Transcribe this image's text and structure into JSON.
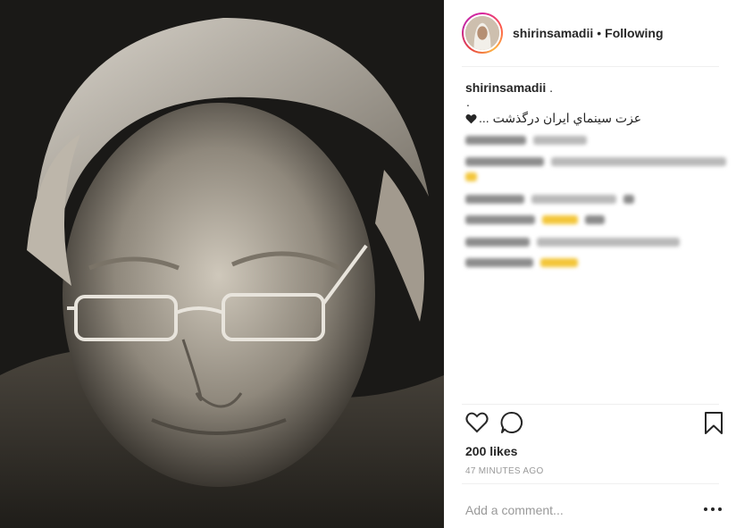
{
  "post": {
    "username": "shirinsamadii",
    "separator": "•",
    "follow_status": "Following",
    "caption_username": "shirinsamadii",
    "caption_trail": " .",
    "caption_dot": ".",
    "caption_text": "... عزت سينماي ايران درگذشت",
    "likes": "200 likes",
    "timestamp": "47 MINUTES AGO",
    "comment_placeholder": "Add a comment..."
  },
  "icons": {
    "caption_heart": "heart-icon",
    "like": "heart-outline-icon",
    "comment": "comment-bubble-icon",
    "save": "bookmark-icon",
    "more": "more-options-icon"
  },
  "colors": {
    "text": "#262626",
    "muted": "#999999",
    "divider": "#efefef",
    "photo_bg": "#1a1917"
  }
}
